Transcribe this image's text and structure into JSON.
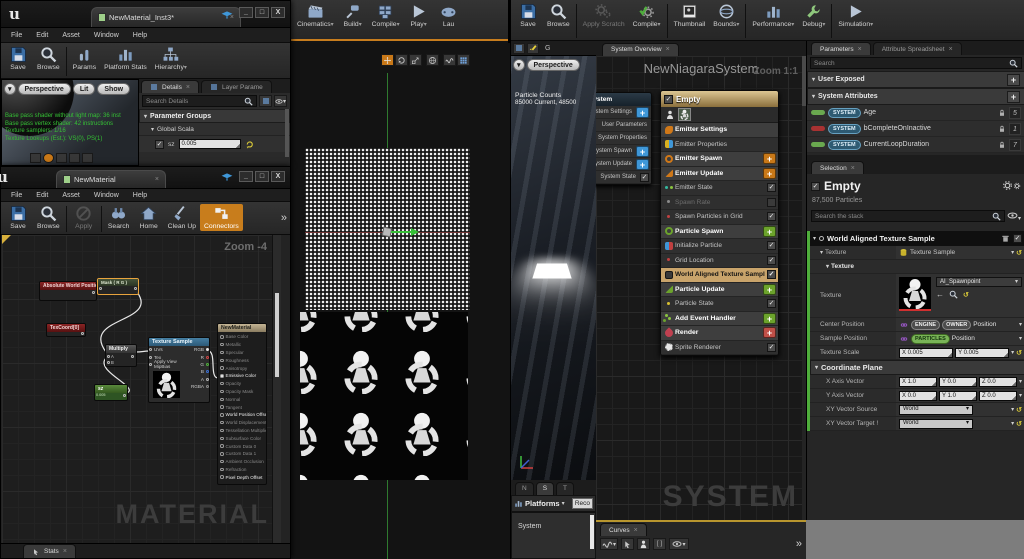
{
  "chrome": {
    "logo": "u",
    "min": "_",
    "max": "□",
    "close": "X"
  },
  "mi_window": {
    "tab": "NewMaterial_Inst3*",
    "menu": [
      "File",
      "Edit",
      "Asset",
      "Window",
      "Help"
    ],
    "toolbar": [
      {
        "label": "Save",
        "icon": "floppy"
      },
      {
        "label": "Browse",
        "icon": "mag"
      },
      {
        "label": "Params",
        "icon": "bars"
      },
      {
        "label": "Platform Stats",
        "icon": "chart"
      },
      {
        "label": "Hierarchy",
        "icon": "tree",
        "arrow": true
      }
    ],
    "viewport": {
      "dropdown": "▾",
      "perspective": "Perspective",
      "lit": "Lit",
      "show": "Show",
      "stats": [
        "Base pass shader without light map: 36 inst",
        "Base pass vertex shader: 42 instructions",
        "Texture samplers: 1/16",
        "Texture Lookups (Est.): VS(0), PS(1)"
      ]
    },
    "details": {
      "tab_details": "Details",
      "tab_layer": "Layer Parame",
      "search": "Search Details",
      "group": "Parameter Groups",
      "subgroup": "Global Scala",
      "param_name": "sz",
      "param_value": "0.005"
    }
  },
  "mat_window": {
    "tab": "NewMaterial",
    "menu": [
      "File",
      "Edit",
      "Asset",
      "Window",
      "Help"
    ],
    "toolbar": [
      {
        "label": "Save",
        "icon": "floppy"
      },
      {
        "label": "Browse",
        "icon": "mag"
      },
      {
        "label": "Apply",
        "icon": "slash",
        "dim": true
      },
      {
        "label": "Search",
        "icon": "binoc"
      },
      {
        "label": "Home",
        "icon": "house"
      },
      {
        "label": "Clean Up",
        "icon": "broom"
      },
      {
        "label": "Connectors",
        "icon": "plug",
        "active": true
      }
    ],
    "overflow": "»",
    "zoom": "Zoom -4",
    "watermark": "MATERIAL",
    "stats_tab": "Stats",
    "graph": {
      "awp": "Absolute World Position",
      "mask": "Mask ( R G )",
      "texcoord": "TexCoord[0]",
      "multiply": "Multiply",
      "multiply_a": "A",
      "multiply_b": "B",
      "param_name": "sz",
      "param_value": "0.005",
      "ts_title": "Texture Sample",
      "ts_inputs": [
        "UVs",
        "Tex",
        "Apply View MipBias"
      ],
      "ts_outputs": [
        {
          "name": "RGB",
          "color": "#e8e8e8"
        },
        {
          "name": "R",
          "color": "#d04545"
        },
        {
          "name": "G",
          "color": "#4fae3c"
        },
        {
          "name": "B",
          "color": "#3b6fd4"
        },
        {
          "name": "A",
          "color": "#b5b5b5"
        },
        {
          "name": "RGBA",
          "color": "#8a8a8a"
        }
      ],
      "result_title": "NewMaterial",
      "result_pins": [
        {
          "name": "Base Color"
        },
        {
          "name": "Metallic"
        },
        {
          "name": "Specular"
        },
        {
          "name": "Roughness"
        },
        {
          "name": "Anisotropy"
        },
        {
          "name": "Emissive Color",
          "on": true,
          "filled": true
        },
        {
          "name": "Opacity"
        },
        {
          "name": "Opacity Mask"
        },
        {
          "name": "Normal"
        },
        {
          "name": "Tangent"
        },
        {
          "name": "World Position Offset",
          "on": true
        },
        {
          "name": "World Displacement"
        },
        {
          "name": "Tessellation Multiplier"
        },
        {
          "name": "Subsurface Color"
        },
        {
          "name": "Custom Data 0"
        },
        {
          "name": "Custom Data 1"
        },
        {
          "name": "Ambient Occlusion"
        },
        {
          "name": "Refraction"
        },
        {
          "name": "Pixel Depth Offset",
          "on": true
        }
      ]
    }
  },
  "main_toolbar": [
    {
      "label": "Cinematics",
      "icon": "clapper",
      "arrow": true
    },
    {
      "label": "Build",
      "icon": "build",
      "arrow": true
    },
    {
      "label": "Compile",
      "icon": "bricks",
      "arrow": true
    },
    {
      "label": "Play",
      "icon": "play",
      "arrow": true
    },
    {
      "label": "Lau",
      "icon": "pad"
    }
  ],
  "niagara": {
    "toolbar": [
      {
        "label": "Save",
        "icon": "floppy"
      },
      {
        "label": "Browse",
        "icon": "mag"
      },
      {
        "label": "Apply Scratch",
        "icon": "gears",
        "dim": true
      },
      {
        "label": "Compile",
        "icon": "checkgear",
        "arrow": true
      },
      {
        "label": "Thumbnail",
        "icon": "photo"
      },
      {
        "label": "Bounds",
        "icon": "ring",
        "arrow": true
      },
      {
        "label": "Performance",
        "icon": "chart",
        "arrow": true
      },
      {
        "label": "Debug",
        "icon": "wrench",
        "arrow": true
      },
      {
        "label": "Simulation",
        "icon": "play",
        "arrow": true
      }
    ],
    "overview_tab": "System Overview",
    "title": "NewNiagaraSystem",
    "zoom": "Zoom 1:1",
    "watermark": "SYSTEM",
    "preview": {
      "perspective": "Perspective",
      "counts_title": "Particle Counts",
      "counts_value": "85000 Current, 48500"
    },
    "system_node": {
      "header": "System",
      "rows": [
        {
          "label": "System Settings",
          "widget": "plus-blue"
        },
        {
          "label": "User Parameters",
          "widget": "none"
        },
        {
          "label": "System Properties",
          "widget": "none"
        },
        {
          "label": "System Spawn",
          "widget": "plus-blue"
        },
        {
          "label": "System Update",
          "widget": "plus-blue"
        },
        {
          "label": "System State",
          "widget": "check"
        }
      ]
    },
    "emitter_node": {
      "header": "Empty",
      "rows": [
        {
          "label": "Emitter Settings",
          "icon": "set",
          "style": "group",
          "widget": "none"
        },
        {
          "label": "Emitter Properties",
          "icon": "prop",
          "style": "normal",
          "widget": "none"
        },
        {
          "label": "Emitter Spawn",
          "icon": "ringo",
          "style": "group",
          "widget": "plus-orange"
        },
        {
          "label": "Emitter Update",
          "icon": "arrow-orange",
          "style": "group",
          "widget": "plus-orange"
        },
        {
          "label": "Emitter State",
          "icon": "dots",
          "style": "normal",
          "widget": "check"
        },
        {
          "label": "Spawn Rate",
          "icon": "dot-gray",
          "style": "disabled",
          "widget": "check-off"
        },
        {
          "label": "Spawn Particles in Grid",
          "icon": "dot-red",
          "style": "normal",
          "widget": "check"
        },
        {
          "label": "Particle Spawn",
          "icon": "ringg",
          "style": "group",
          "widget": "plus-green"
        },
        {
          "label": "Initialize Particle",
          "icon": "init",
          "style": "normal",
          "widget": "check"
        },
        {
          "label": "Grid Location",
          "icon": "dot-red",
          "style": "normal",
          "widget": "check"
        },
        {
          "label": "World Aligned Texture Sample",
          "icon": "sq-dark",
          "style": "highlight",
          "widget": "check"
        },
        {
          "label": "Particle Update",
          "icon": "arrow-green",
          "style": "group",
          "widget": "plus-green"
        },
        {
          "label": "Particle State",
          "icon": "dot-yellow",
          "style": "normal",
          "widget": "check"
        },
        {
          "label": "Add Event Handler",
          "icon": "ev-green",
          "style": "group",
          "widget": "plus-green"
        },
        {
          "label": "Render",
          "icon": "heart-red",
          "style": "group",
          "widget": "plus-red"
        },
        {
          "label": "Sprite Renderer",
          "icon": "sun",
          "style": "normal",
          "widget": "check"
        }
      ]
    },
    "bottom": {
      "tabs": [
        "N",
        "S",
        "T"
      ],
      "active_tab": "S",
      "platforms": "Platforms",
      "rec": "Reco",
      "list_item": "System",
      "curves_tab": "Curves"
    }
  },
  "params_panel": {
    "tab_parameters": "Parameters",
    "tab_spreadsheet": "Attribute Spreadsheet",
    "search": "Search",
    "sec_user": "User Exposed",
    "sec_system": "System Attributes",
    "attributes": [
      {
        "ns": "SYSTEM",
        "name": "Age",
        "count": "5",
        "pill": "#6aa84f"
      },
      {
        "ns": "SYSTEM",
        "name": "bCompleteOnInactive",
        "count": "1",
        "pill": "#a83232"
      },
      {
        "ns": "SYSTEM",
        "name": "CurrentLoopDuration",
        "count": "7",
        "pill": "#6aa84f"
      }
    ]
  },
  "selection": {
    "tab": "Selection",
    "title": "Empty",
    "particles": "87,500 Particles",
    "search": "Search the stack",
    "module_title": "World Aligned Texture Sample",
    "texture_group": "Texture",
    "texture_sample": "Texture Sample",
    "texture_sub": "Texture",
    "texture_label": "Texture",
    "texture_asset": "AI_Spawnpoint",
    "center_label": "Center Position",
    "badge_engine": "ENGINE",
    "badge_owner": "OWNER",
    "center_value": "Position",
    "sample_label": "Sample Position",
    "badge_particles": "PARTICLES",
    "sample_value": "Position",
    "scale_label": "Texture Scale",
    "scale_x": "X 0.005",
    "scale_y": "Y 0.005",
    "coord_header": "Coordinate Plane",
    "xaxis_label": "X Axis Vector",
    "xaxis": [
      "X 1.0",
      "Y 0.0",
      "Z 0.0"
    ],
    "yaxis_label": "Y Axis Vector",
    "yaxis": [
      "X 0.0",
      "Y 1.0",
      "Z 0.0"
    ],
    "xysrc_label": "XY Vector Source",
    "xysrc_value": "World",
    "xytgt_label": "XY Vector Target !",
    "xytgt_value": "World"
  }
}
